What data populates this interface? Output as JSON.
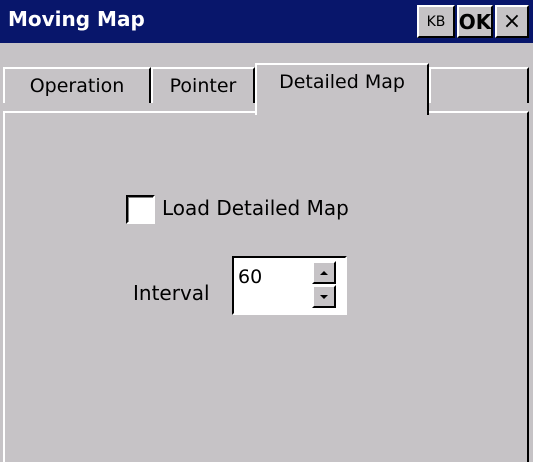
{
  "window": {
    "title": "Moving Map",
    "colors": {
      "titlebar": "#08166b",
      "face": "#c6c3c6"
    }
  },
  "titlebar": {
    "kb_label": "KB",
    "ok_label": "OK",
    "close_label": "×",
    "close_icon": "close-icon"
  },
  "tabs": [
    {
      "label": "Operation",
      "selected": false
    },
    {
      "label": "Pointer",
      "selected": false
    },
    {
      "label": "Detailed Map",
      "selected": true
    }
  ],
  "panel": {
    "load_detailed_map": {
      "label": "Load Detailed Map",
      "checked": false
    },
    "interval": {
      "label": "Interval",
      "value": "60"
    }
  }
}
